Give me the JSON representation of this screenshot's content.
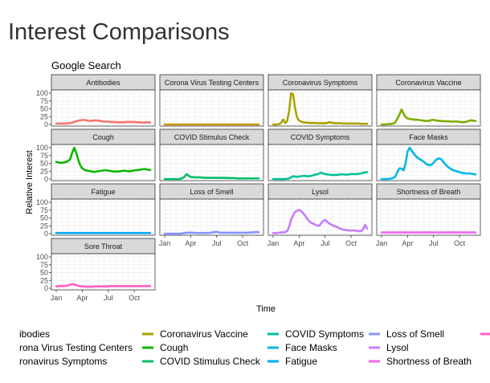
{
  "page": {
    "title": "Interest Comparisons"
  },
  "chart_data": {
    "type": "line",
    "title": "Google Search",
    "xlabel": "Time",
    "ylabel": "Relative Interest",
    "ylim": [
      0,
      100
    ],
    "y_ticks": [
      "0",
      "25",
      "50",
      "75",
      "100"
    ],
    "x_ticks": [
      "Jan",
      "Apr",
      "Jul",
      "Oct"
    ],
    "x_tick_values": [
      1,
      14,
      27,
      40
    ],
    "x_range": [
      1,
      48
    ],
    "grid": true,
    "legend_position": "bottom",
    "legend_entries": [
      "ibodies",
      "rona Virus Testing Centers",
      "ronavirus Symptoms",
      "Coronavirus Vaccine",
      "Cough",
      "COVID Stimulus Check",
      "COVID Symptoms",
      "Face Masks",
      "Fatigue",
      "Loss of Smell",
      "Lysol",
      "Shortness of Breath"
    ],
    "x_week_numbers": [
      1,
      2,
      3,
      4,
      5,
      6,
      7,
      8,
      9,
      10,
      11,
      12,
      13,
      14,
      15,
      16,
      17,
      18,
      19,
      20,
      21,
      22,
      23,
      24,
      25,
      26,
      27,
      28,
      29,
      30,
      31,
      32,
      33,
      34,
      35,
      36,
      37,
      38,
      39,
      40,
      41,
      42,
      43,
      44,
      45,
      46,
      47,
      48
    ],
    "series": [
      {
        "name": "Antibodies",
        "color": "#F8766D",
        "values": [
          3,
          3,
          3,
          3,
          3,
          3,
          4,
          5,
          6,
          8,
          10,
          12,
          13,
          14,
          14,
          13,
          12,
          11,
          12,
          13,
          13,
          12,
          11,
          10,
          9,
          9,
          9,
          8,
          8,
          8,
          7,
          7,
          7,
          7,
          7,
          8,
          8,
          8,
          8,
          8,
          7,
          7,
          7,
          6,
          6,
          7,
          7,
          6
        ]
      },
      {
        "name": "Corona Virus Testing Centers",
        "color": "#CD9600",
        "values": [
          0,
          0,
          0,
          0,
          0,
          0,
          0,
          0,
          0,
          0,
          0,
          0,
          0,
          0,
          0,
          0,
          0,
          0,
          0,
          0,
          0,
          0,
          0,
          0,
          0,
          0,
          0,
          0,
          0,
          0,
          0,
          0,
          0,
          0,
          0,
          0,
          0,
          0,
          0,
          0,
          0,
          0,
          0,
          0,
          0,
          0,
          0,
          0
        ]
      },
      {
        "name": "Coronavirus Symptoms",
        "color": "#ABA300",
        "values": [
          0,
          0,
          0,
          1,
          5,
          16,
          5,
          10,
          42,
          100,
          96,
          50,
          22,
          12,
          9,
          7,
          6,
          6,
          5,
          5,
          5,
          5,
          4,
          4,
          4,
          4,
          4,
          5,
          7,
          6,
          5,
          4,
          4,
          4,
          4,
          3,
          3,
          3,
          3,
          3,
          3,
          3,
          3,
          3,
          2,
          2,
          2,
          2
        ]
      },
      {
        "name": "Coronavirus Vaccine",
        "color": "#7CAE00",
        "values": [
          0,
          0,
          0,
          1,
          1,
          2,
          3,
          8,
          20,
          32,
          48,
          34,
          24,
          19,
          18,
          17,
          16,
          15,
          15,
          14,
          13,
          12,
          11,
          11,
          12,
          14,
          15,
          13,
          12,
          11,
          11,
          10,
          10,
          10,
          10,
          9,
          9,
          10,
          9,
          8,
          8,
          7,
          8,
          10,
          12,
          13,
          12,
          11
        ]
      },
      {
        "name": "Cough",
        "color": "#0CB702",
        "values": [
          55,
          53,
          52,
          52,
          53,
          55,
          58,
          64,
          84,
          100,
          83,
          62,
          44,
          34,
          30,
          28,
          26,
          25,
          24,
          23,
          24,
          25,
          26,
          27,
          28,
          28,
          27,
          26,
          25,
          24,
          24,
          24,
          25,
          26,
          27,
          26,
          25,
          25,
          26,
          28,
          28,
          29,
          30,
          31,
          32,
          31,
          30,
          29
        ]
      },
      {
        "name": "COVID Stimulus Check",
        "color": "#00BE67",
        "values": [
          0,
          0,
          0,
          0,
          0,
          0,
          0,
          0,
          1,
          3,
          8,
          16,
          10,
          7,
          6,
          6,
          5,
          6,
          5,
          5,
          4,
          4,
          4,
          4,
          4,
          4,
          4,
          4,
          4,
          4,
          3,
          4,
          3,
          3,
          3,
          3,
          2,
          2,
          2,
          2,
          2,
          2,
          2,
          2,
          2,
          2,
          2,
          2
        ]
      },
      {
        "name": "COVID Symptoms",
        "color": "#00C19A",
        "values": [
          0,
          0,
          0,
          0,
          0,
          0,
          0,
          1,
          2,
          6,
          9,
          8,
          7,
          8,
          9,
          10,
          10,
          9,
          9,
          10,
          12,
          14,
          15,
          18,
          20,
          18,
          16,
          15,
          14,
          13,
          13,
          13,
          13,
          14,
          15,
          15,
          14,
          14,
          15,
          16,
          16,
          16,
          16,
          17,
          18,
          20,
          21,
          22
        ]
      },
      {
        "name": "Face Masks",
        "color": "#00B8E7",
        "values": [
          0,
          0,
          0,
          0,
          1,
          2,
          4,
          9,
          24,
          34,
          33,
          28,
          50,
          88,
          100,
          92,
          82,
          74,
          68,
          64,
          60,
          56,
          50,
          46,
          44,
          46,
          52,
          60,
          64,
          66,
          62,
          54,
          46,
          40,
          35,
          31,
          28,
          26,
          24,
          22,
          20,
          19,
          18,
          18,
          18,
          17,
          16,
          15
        ]
      },
      {
        "name": "Fatigue",
        "color": "#00A9FF",
        "values": [
          2,
          2,
          2,
          2,
          2,
          2,
          2,
          2,
          2,
          2,
          2,
          2,
          2,
          2,
          2,
          2,
          2,
          2,
          2,
          2,
          2,
          2,
          2,
          2,
          2,
          2,
          2,
          2,
          2,
          2,
          2,
          2,
          2,
          2,
          2,
          2,
          2,
          2,
          2,
          2,
          2,
          2,
          2,
          2,
          2,
          2,
          2,
          2
        ]
      },
      {
        "name": "Loss of Smell",
        "color": "#8494FF",
        "values": [
          0,
          0,
          0,
          0,
          0,
          0,
          0,
          0,
          0,
          1,
          2,
          3,
          3,
          3,
          3,
          2,
          2,
          2,
          2,
          2,
          2,
          2,
          2,
          3,
          4,
          5,
          6,
          4,
          3,
          3,
          3,
          3,
          3,
          3,
          3,
          3,
          3,
          3,
          3,
          3,
          3,
          3,
          3,
          4,
          4,
          5,
          5,
          5
        ]
      },
      {
        "name": "Lysol",
        "color": "#C77CFF",
        "values": [
          2,
          2,
          2,
          3,
          4,
          4,
          5,
          8,
          22,
          45,
          58,
          70,
          73,
          76,
          72,
          66,
          58,
          48,
          40,
          35,
          32,
          29,
          26,
          25,
          33,
          40,
          44,
          38,
          33,
          29,
          26,
          23,
          21,
          18,
          15,
          13,
          12,
          11,
          10,
          10,
          10,
          10,
          9,
          8,
          8,
          14,
          28,
          16
        ]
      },
      {
        "name": "Shortness of Breath",
        "color": "#ED68ED",
        "values": [
          4,
          4,
          4,
          4,
          4,
          4,
          4,
          4,
          4,
          4,
          4,
          4,
          4,
          4,
          4,
          4,
          4,
          4,
          4,
          4,
          4,
          4,
          4,
          4,
          4,
          4,
          4,
          4,
          4,
          4,
          4,
          4,
          4,
          4,
          4,
          4,
          4,
          4,
          4,
          4,
          4,
          4,
          4,
          4,
          4,
          4,
          4,
          4
        ]
      },
      {
        "name": "Sore Throat",
        "color": "#FF61C3",
        "values": [
          6,
          7,
          7,
          7,
          7,
          8,
          9,
          11,
          13,
          12,
          10,
          8,
          7,
          6,
          6,
          5,
          5,
          5,
          5,
          6,
          6,
          6,
          6,
          6,
          6,
          6,
          6,
          7,
          7,
          7,
          7,
          7,
          7,
          7,
          7,
          7,
          7,
          7,
          7,
          7,
          7,
          7,
          7,
          7,
          7,
          7,
          7,
          7
        ]
      }
    ]
  }
}
